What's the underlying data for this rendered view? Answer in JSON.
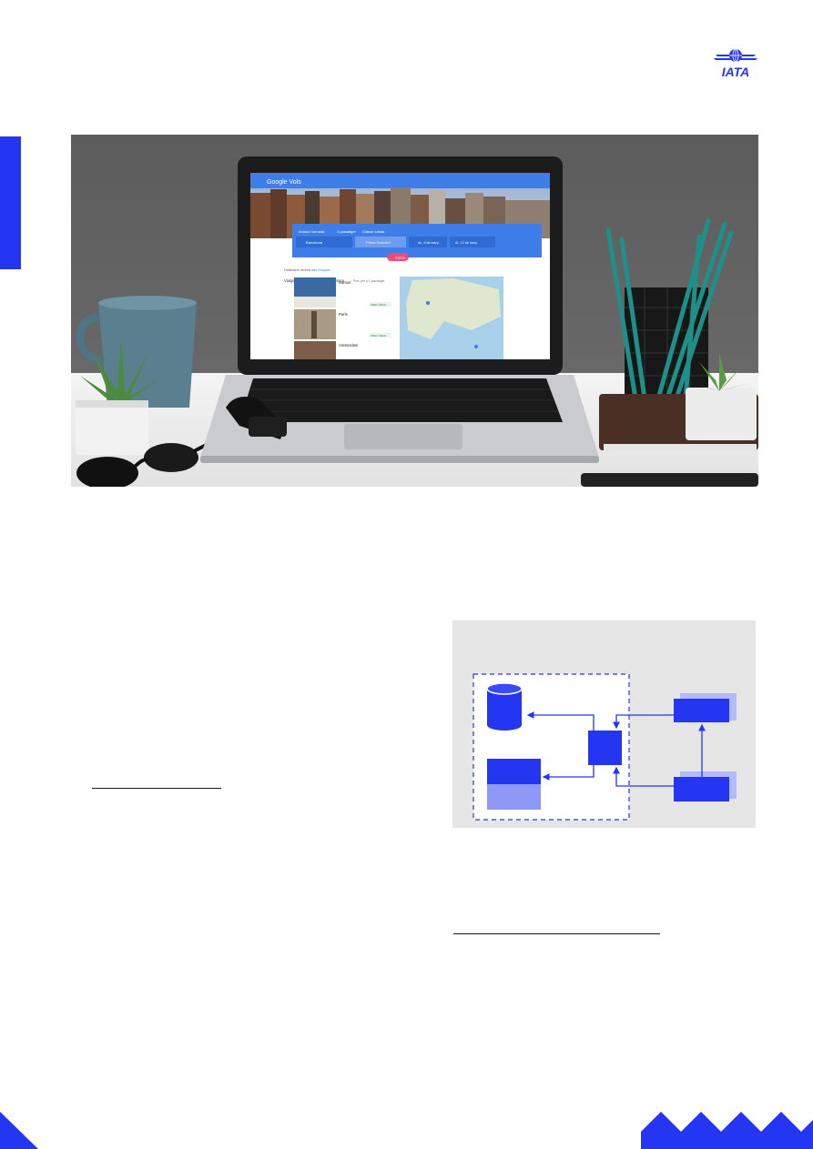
{
  "brand": {
    "logo_text": "IATA"
  },
  "colors": {
    "accent": "#2436f2",
    "accent_light": "#8f97f7",
    "diagram_bg": "#e6e6e6"
  },
  "hero": {
    "screen": {
      "app_title": "Google Vols",
      "trip_type": "Anada i tornada",
      "passengers": "1 passatger",
      "cabin_class": "Classe turista",
      "origin": "Barcelona",
      "destination_placeholder": "Prova Toronto?",
      "depart_date": "dv., 9 de març.",
      "return_date": "dl., 12 de març.",
      "search_button": "Cerca",
      "explore_label": "Destinació recent:",
      "explore_link": "Llista d'espais",
      "suggested_heading": "Viatges suggerits des de Barcelona",
      "suggested_meta": "Preu per a 1 passatger",
      "explore_destinations": "Explora destinacions",
      "price_tag": "PREU IDEAL",
      "destinations": [
        {
          "name": "Santorí"
        },
        {
          "name": "París"
        },
        {
          "name": "Amsterdam"
        }
      ]
    }
  },
  "diagram": {
    "boxes": 5
  }
}
